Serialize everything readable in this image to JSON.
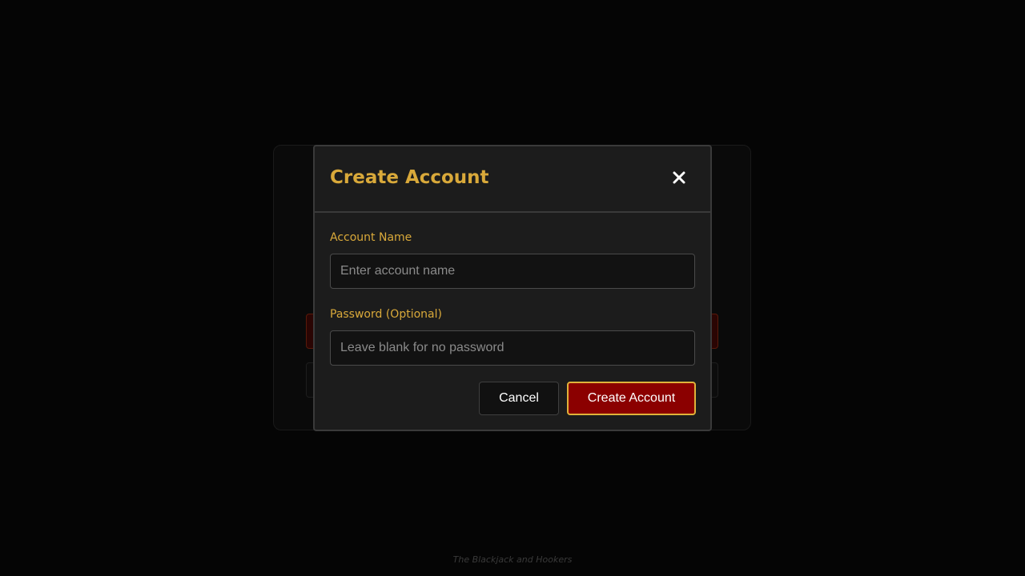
{
  "modal": {
    "title": "Create Account",
    "close_icon": "close-icon",
    "account_name": {
      "label": "Account Name",
      "placeholder": "Enter account name",
      "value": ""
    },
    "password": {
      "label": "Password (Optional)",
      "placeholder": "Leave blank for no password",
      "value": ""
    },
    "cancel_label": "Cancel",
    "create_label": "Create Account"
  },
  "footer": {
    "text": "The Blackjack and Hookers"
  },
  "colors": {
    "background": "#050505",
    "modal_bg": "#1c1c1c",
    "accent_gold": "#d9a93a",
    "primary_red": "#8b0000"
  }
}
